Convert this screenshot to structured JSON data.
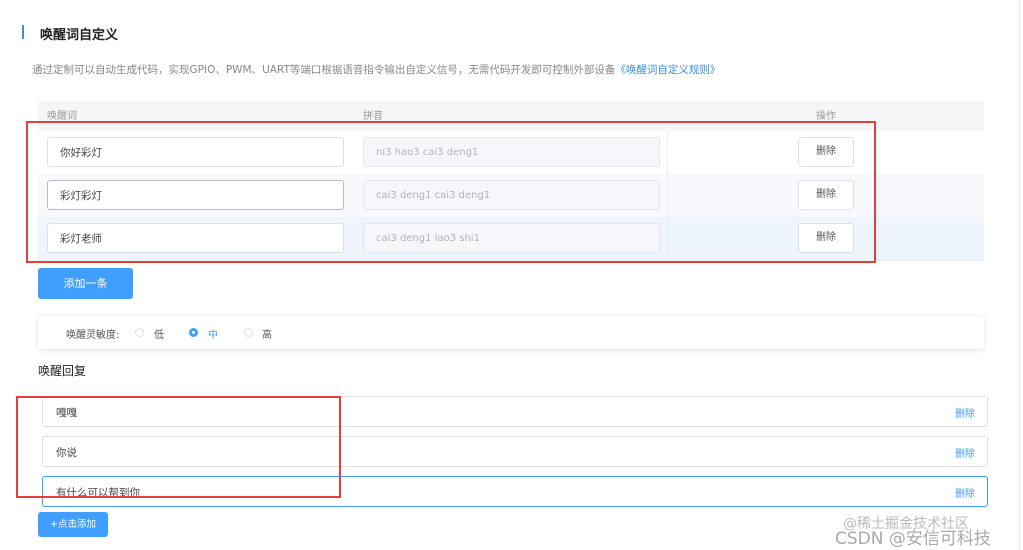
{
  "section": {
    "title": "唤醒词自定义",
    "description": "通过定制可以自动生成代码，实现GPIO、PWM、UART等端口根据语音指令输出自定义信号，无需代码开发即可控制外部设备",
    "rule_link": "《唤醒词自定义规则》"
  },
  "table": {
    "headers": [
      "唤醒词",
      "拼音",
      "操作"
    ],
    "rows": [
      {
        "word": "你好彩灯",
        "pinyin": "ni3 hao3 cai3 deng1",
        "action": "删除"
      },
      {
        "word": "彩灯彩灯",
        "pinyin": "cai3 deng1 cai3 deng1",
        "action": "删除"
      },
      {
        "word": "彩灯老师",
        "pinyin": "cai3 deng1 lao3 shi1",
        "action": "删除"
      }
    ]
  },
  "add_button": "添加一条",
  "sensitivity": {
    "label": "唤醒灵敏度:",
    "options": [
      "低",
      "中",
      "高"
    ],
    "selected": "中"
  },
  "reply": {
    "title": "唤醒回复",
    "items": [
      {
        "text": "嘎嘎",
        "action": "删除"
      },
      {
        "text": "你说",
        "action": "删除"
      },
      {
        "text": "有什么可以帮到你",
        "action": "删除"
      }
    ],
    "add_button": "+点击添加"
  },
  "watermarks": {
    "line1": "@稀土掘金技术社区",
    "line2": "CSDN @安信可科技"
  },
  "colors": {
    "accent": "#409eff",
    "highlight_box": "#e3403a"
  }
}
